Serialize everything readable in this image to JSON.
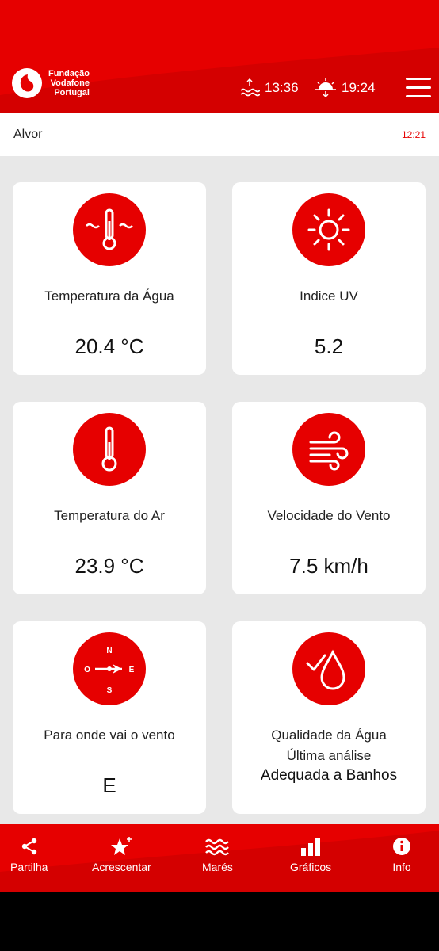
{
  "brand": {
    "line1": "Fundação",
    "line2": "Vodafone",
    "line3": "Portugal",
    "accent_color": "#e60000"
  },
  "header": {
    "tide_rise_time": "13:36",
    "sunset_time": "19:24",
    "menu_icon": "hamburger-icon"
  },
  "location": {
    "name": "Alvor",
    "updated": "12:21"
  },
  "cards": {
    "water_temp": {
      "label": "Temperatura da Água",
      "value": "20.4 °C"
    },
    "uv_index": {
      "label": "Indice UV",
      "value": "5.2"
    },
    "air_temp": {
      "label": "Temperatura do Ar",
      "value": "23.9 °C"
    },
    "wind_speed": {
      "label": "Velocidade do Vento",
      "value": "7.5 km/h"
    },
    "wind_direction": {
      "label": "Para onde vai o vento",
      "value": "E",
      "compass": {
        "n": "N",
        "s": "S",
        "e": "E",
        "o": "O"
      }
    },
    "water_quality": {
      "label": "Qualidade da Água",
      "sublabel": "Última análise",
      "value": "Adequada a Banhos"
    }
  },
  "nav": [
    {
      "label": "Partilha",
      "icon": "share-icon"
    },
    {
      "label": "Acrescentar",
      "icon": "star-plus-icon"
    },
    {
      "label": "Marés",
      "icon": "waves-icon"
    },
    {
      "label": "Gráficos",
      "icon": "bar-chart-icon"
    },
    {
      "label": "Info",
      "icon": "info-icon"
    }
  ]
}
